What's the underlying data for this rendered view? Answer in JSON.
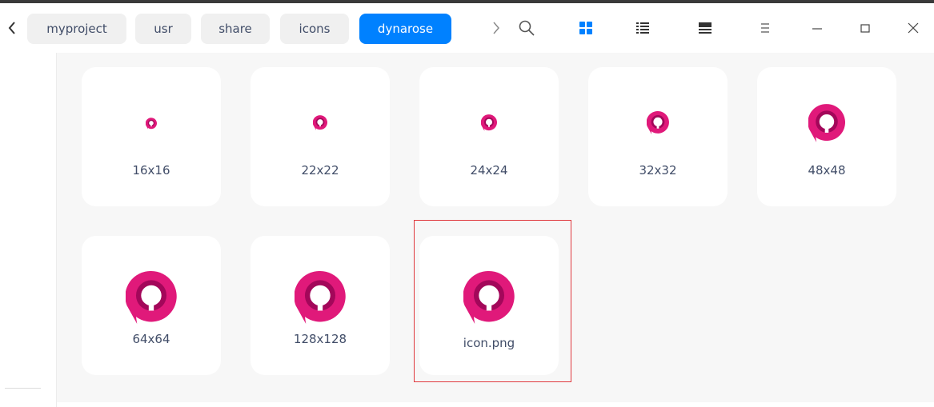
{
  "breadcrumbs": [
    {
      "label": "myproject",
      "active": false
    },
    {
      "label": "usr",
      "active": false
    },
    {
      "label": "share",
      "active": false
    },
    {
      "label": "icons",
      "active": false
    },
    {
      "label": "dynarose",
      "active": true
    }
  ],
  "toolbar": {
    "back_icon": "chevron-left-icon",
    "forward_icon": "chevron-right-icon",
    "search_icon": "search-icon",
    "icon_view_icon": "grid-view-icon",
    "list_view_icon": "list-view-icon",
    "tree_view_icon": "detail-view-icon",
    "menu_icon": "menu-icon",
    "minimize_icon": "minimize-icon",
    "maximize_icon": "maximize-icon",
    "close_icon": "close-icon"
  },
  "items": [
    {
      "label": "16x16",
      "icon": "dynarose-app-icon"
    },
    {
      "label": "22x22",
      "icon": "dynarose-app-icon"
    },
    {
      "label": "24x24",
      "icon": "dynarose-app-icon"
    },
    {
      "label": "32x32",
      "icon": "dynarose-app-icon"
    },
    {
      "label": "48x48",
      "icon": "dynarose-app-icon"
    },
    {
      "label": "64x64",
      "icon": "dynarose-app-icon"
    },
    {
      "label": "128x128",
      "icon": "dynarose-app-icon"
    },
    {
      "label": "icon.png",
      "icon": "dynarose-app-icon",
      "highlighted": true
    }
  ],
  "colors": {
    "accent": "#0081ff",
    "icon_outer": "#e0197a",
    "icon_inner": "#a3075a",
    "highlight": "#e0393e"
  }
}
